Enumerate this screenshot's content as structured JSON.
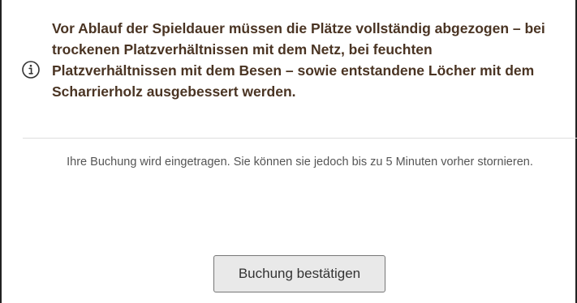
{
  "notice": {
    "icon": "info-icon",
    "text": "Vor Ablauf der Spieldauer müssen die Plätze vollständig abgezogen – bei trockenen Platzverhältnissen mit dem Netz, bei feuchten Platzverhältnissen mit dem Besen – sowie entstandene Löcher mit dem Scharrierholz ausgebessert werden.",
    "text_color": "#4a3423"
  },
  "booking": {
    "info_text": "Ihre Buchung wird eingetragen. Sie können sie jedoch bis zu 5 Minuten vorher stornieren.",
    "confirm_label": "Buchung bestätigen"
  }
}
